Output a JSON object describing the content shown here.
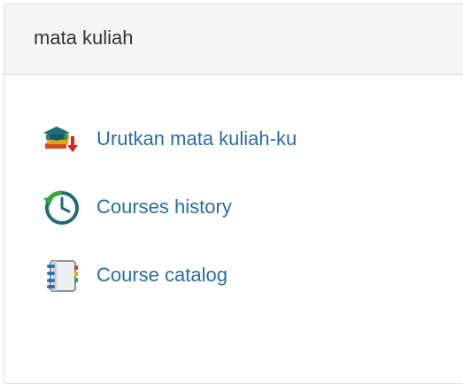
{
  "panel": {
    "title": "mata kuliah"
  },
  "nav": {
    "items": [
      {
        "label": "Urutkan mata kuliah-ku",
        "icon": "course-sort-icon"
      },
      {
        "label": "Courses history",
        "icon": "history-clock-icon"
      },
      {
        "label": "Course catalog",
        "icon": "catalog-notebook-icon"
      }
    ]
  },
  "colors": {
    "link": "#2b6ca8",
    "heading_bg": "#f5f5f5",
    "border": "#dddddd"
  }
}
